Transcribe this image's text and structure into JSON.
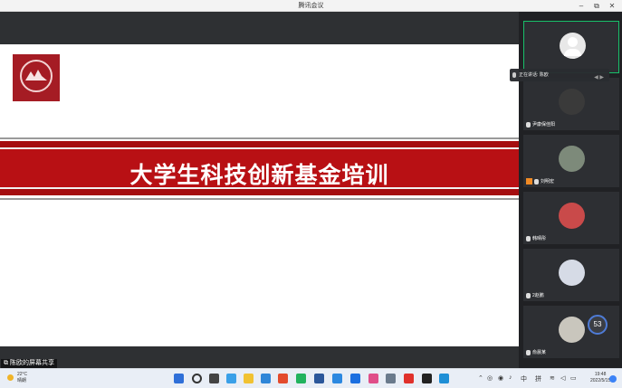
{
  "window": {
    "title": "腾讯会议",
    "controls": [
      "–",
      "⧉",
      "✕"
    ]
  },
  "slide": {
    "title": "大学生科技创新基金培训"
  },
  "share_label": "陈欧的屏幕共享",
  "speaking": {
    "text": "正在讲话: 陈欧"
  },
  "participants": [
    {
      "name": "",
      "avatar": "default"
    },
    {
      "name": "尹康保佳阳",
      "avatar": "photo"
    },
    {
      "name": "刘明宏",
      "avatar": "photo"
    },
    {
      "name": "韩晴彤",
      "avatar": "photo"
    },
    {
      "name": "2赵鹏",
      "avatar": "photo"
    },
    {
      "name": "俞晨某",
      "avatar": "photo"
    }
  ],
  "network_badge": "53",
  "taskbar": {
    "weather_temp": "22°C",
    "weather_desc": "晴朗",
    "ime_lang": "中",
    "ime_mode": "拼",
    "time": "19:48",
    "date": "2022/5/15"
  }
}
